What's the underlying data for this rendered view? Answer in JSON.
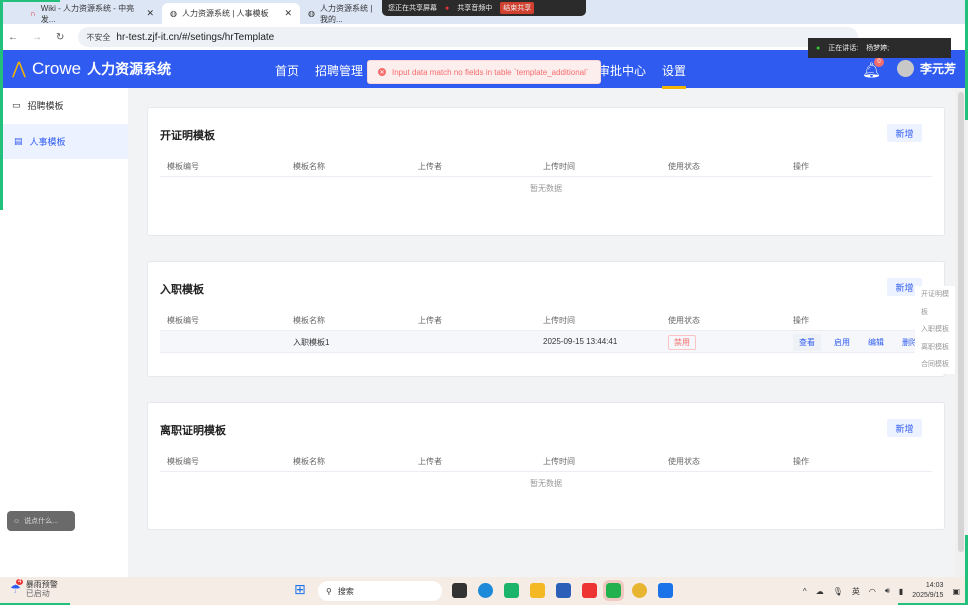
{
  "browser": {
    "tabs": [
      {
        "title": "Wiki - 人力资源系统 - 中亮发..."
      },
      {
        "title": "人力资源系统 | 人事模板"
      },
      {
        "title": "人力资源系统 | 我的..."
      }
    ],
    "url": "hr-test.zjf-it.cn/#/setings/hrTemplate",
    "insecure": "不安全"
  },
  "share": {
    "status": "您正在共享屏幕",
    "audio": "共享音频中",
    "end": "结束共享"
  },
  "speaker": {
    "label": "正在讲话:",
    "name": "杨梦婷;"
  },
  "header": {
    "brand": "Crowe",
    "system": "人力资源系统",
    "nav": [
      "首页",
      "招聘管理",
      "审批中心",
      "设置"
    ],
    "notifications": "0",
    "user": "李元芳"
  },
  "toast": {
    "message": "Input data match no fields in table `template_additional`"
  },
  "sidebar": {
    "items": [
      {
        "label": "招聘模板"
      },
      {
        "label": "人事模板"
      }
    ]
  },
  "columns": [
    "模板编号",
    "模板名称",
    "上传者",
    "上传时间",
    "使用状态",
    "操作"
  ],
  "add_label": "新增",
  "empty": "暂无数据",
  "cards": [
    {
      "title": "开证明模板"
    },
    {
      "title": "入职模板",
      "rows": [
        {
          "id": "",
          "name": "入职模板1",
          "uploader": "",
          "time": "2025-09-15 13:44:41",
          "status": "禁用",
          "actions": [
            "查看",
            "启用",
            "编辑",
            "删除"
          ]
        }
      ]
    },
    {
      "title": "离职证明模板"
    }
  ],
  "anchors": [
    "开证明模板",
    "入职模板",
    "离职模板",
    "合同模板"
  ],
  "chat_placeholder": "说点什么...",
  "taskbar": {
    "weather_title": "暴雨预警",
    "weather_sub": "已启动",
    "weather_badge": "4",
    "search": "搜索",
    "ime": "英",
    "time": "14:03",
    "date": "2025/9/15"
  }
}
